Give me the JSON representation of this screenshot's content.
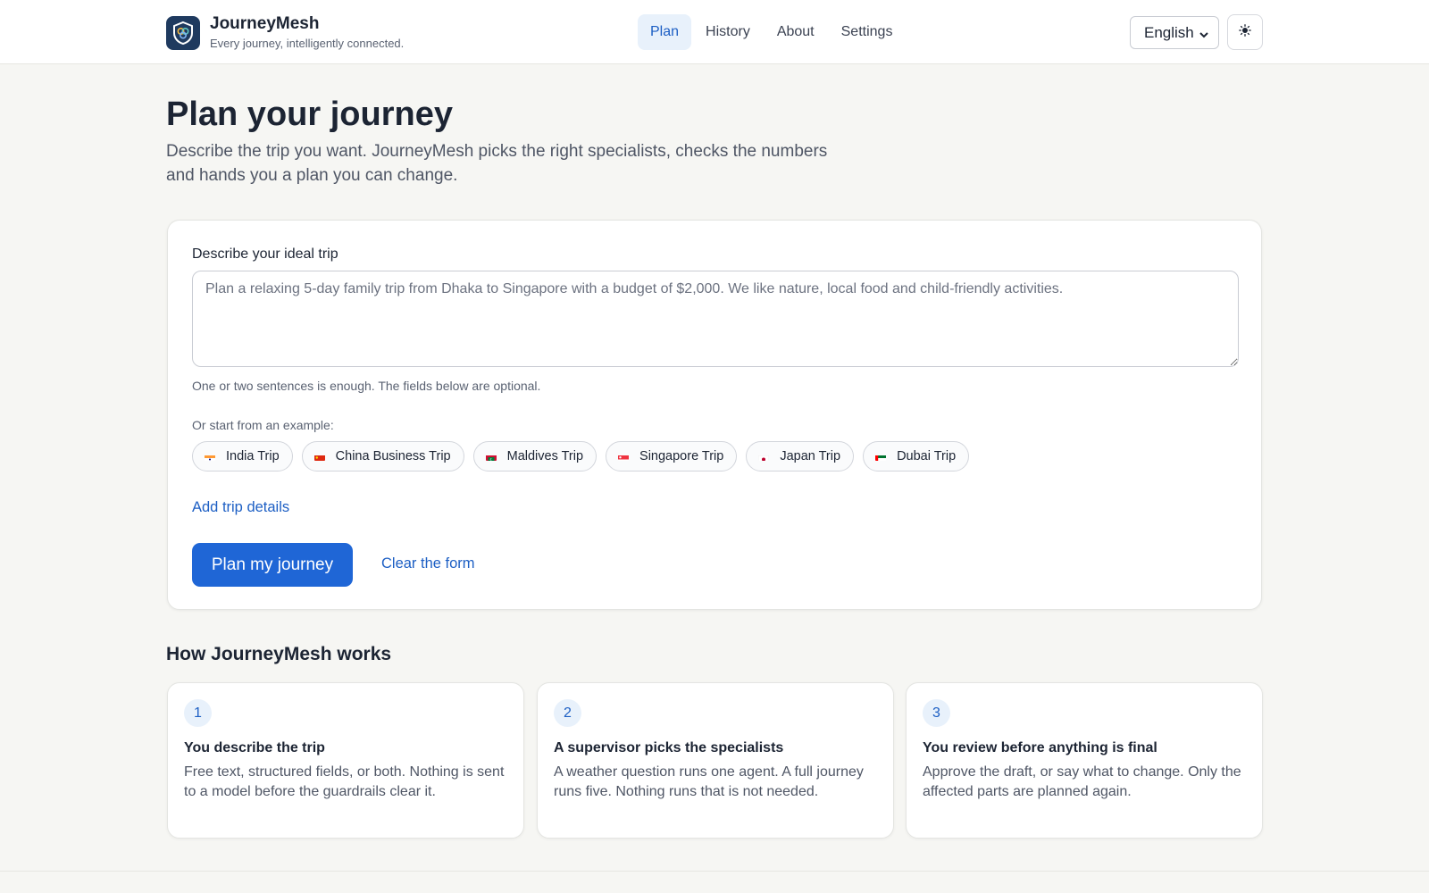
{
  "header": {
    "brand_name": "JourneyMesh",
    "brand_tagline": "Every journey, intelligently connected.",
    "nav": [
      {
        "label": "Plan",
        "active": true
      },
      {
        "label": "History",
        "active": false
      },
      {
        "label": "About",
        "active": false
      },
      {
        "label": "Settings",
        "active": false
      }
    ],
    "language_select": {
      "value": "English",
      "options": [
        "English"
      ]
    },
    "theme_toggle_icon": "sun-icon"
  },
  "hero": {
    "title": "Plan your journey",
    "subtitle": "Describe the trip you want. JourneyMesh picks the right specialists, checks the numbers and hands you a plan you can change."
  },
  "form": {
    "label": "Describe your ideal trip",
    "textarea_value": "",
    "textarea_placeholder": "Plan a relaxing 5-day family trip from Dhaka to Singapore with a budget of $2,000. We like nature, local food and child-friendly activities.",
    "hint": "One or two sentences is enough. The fields below are optional.",
    "examples_label": "Or start from an example:",
    "examples": [
      {
        "label": "India Trip",
        "flag": "india-flag-icon"
      },
      {
        "label": "China Business Trip",
        "flag": "china-flag-icon"
      },
      {
        "label": "Maldives Trip",
        "flag": "maldives-flag-icon"
      },
      {
        "label": "Singapore Trip",
        "flag": "singapore-flag-icon"
      },
      {
        "label": "Japan Trip",
        "flag": "japan-flag-icon"
      },
      {
        "label": "Dubai Trip",
        "flag": "uae-flag-icon"
      }
    ],
    "add_details_label": "Add trip details",
    "submit_label": "Plan my journey",
    "clear_label": "Clear the form"
  },
  "how_it_works": {
    "title": "How JourneyMesh works",
    "steps": [
      {
        "number": "1",
        "title": "You describe the trip",
        "body": "Free text, structured fields, or both. Nothing is sent to a model before the guardrails clear it."
      },
      {
        "number": "2",
        "title": "A supervisor picks the specialists",
        "body": "A weather question runs one agent. A full journey runs five. Nothing runs that is not needed."
      },
      {
        "number": "3",
        "title": "You review before anything is final",
        "body": "Approve the draft, or say what to change. Only the affected parts are planned again."
      }
    ]
  },
  "colors": {
    "accent": "#1f66d6",
    "link": "#1d5fc4",
    "page_background": "#f6f6f3",
    "logo_background": "#1f3a5f"
  }
}
